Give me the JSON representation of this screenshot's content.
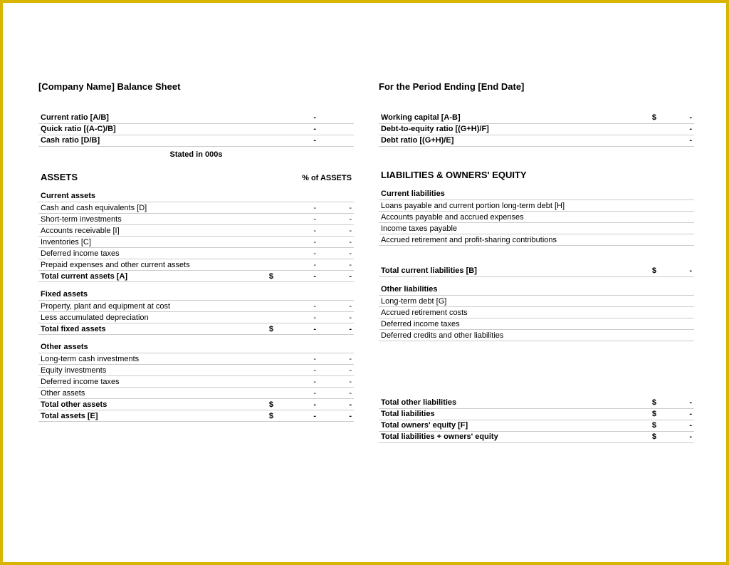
{
  "left": {
    "title": "[Company Name] Balance Sheet",
    "ratios": [
      {
        "label": "Current ratio  [A/B]",
        "value": "-"
      },
      {
        "label": "Quick ratio  [(A-C)/B]",
        "value": "-"
      },
      {
        "label": "Cash ratio  [D/B]",
        "value": "-"
      }
    ],
    "stated": "Stated in 000s",
    "section": "ASSETS",
    "pct_label": "% of ASSETS",
    "current_assets_head": "Current assets",
    "current_assets": [
      {
        "label": "Cash and cash equivalents  [D]",
        "v1": "-",
        "v2": "-"
      },
      {
        "label": "Short-term investments",
        "v1": "-",
        "v2": "-"
      },
      {
        "label": "Accounts receivable  [I]",
        "v1": "-",
        "v2": "-"
      },
      {
        "label": "Inventories  [C]",
        "v1": "-",
        "v2": "-"
      },
      {
        "label": "Deferred income taxes",
        "v1": "-",
        "v2": "-"
      },
      {
        "label": "Prepaid expenses and other current assets",
        "v1": "-",
        "v2": "-"
      }
    ],
    "total_current_assets": {
      "label": "Total current assets  [A]",
      "cur": "$",
      "v1": "-",
      "v2": "-"
    },
    "fixed_assets_head": "Fixed assets",
    "fixed_assets": [
      {
        "label": "Property, plant and equipment at cost",
        "v1": "-",
        "v2": "-"
      },
      {
        "label": "Less accumulated depreciation",
        "v1": "-",
        "v2": "-"
      }
    ],
    "total_fixed_assets": {
      "label": "Total fixed assets",
      "cur": "$",
      "v1": "-",
      "v2": "-"
    },
    "other_assets_head": "Other assets",
    "other_assets": [
      {
        "label": "Long-term cash investments",
        "v1": "-",
        "v2": "-"
      },
      {
        "label": "Equity investments",
        "v1": "-",
        "v2": "-"
      },
      {
        "label": "Deferred income taxes",
        "v1": "-",
        "v2": "-"
      },
      {
        "label": "Other assets",
        "v1": "-",
        "v2": "-"
      }
    ],
    "total_other_assets": {
      "label": "Total other assets",
      "cur": "$",
      "v1": "-",
      "v2": "-"
    },
    "total_assets": {
      "label": "Total assets  [E]",
      "cur": "$",
      "v1": "-",
      "v2": "-"
    }
  },
  "right": {
    "title": "For the Period Ending [End Date]",
    "ratios": [
      {
        "label": "Working capital  [A-B]",
        "cur": "$",
        "value": "-"
      },
      {
        "label": "Debt-to-equity ratio  [(G+H)/F]",
        "cur": "",
        "value": "-"
      },
      {
        "label": "Debt ratio  [(G+H)/E]",
        "cur": "",
        "value": "-"
      }
    ],
    "section": "LIABILITIES & OWNERS' EQUITY",
    "current_liab_head": "Current liabilities",
    "current_liab": [
      {
        "label": "Loans payable and current portion long-term debt  [H]"
      },
      {
        "label": "Accounts payable and accrued expenses"
      },
      {
        "label": "Income taxes payable"
      },
      {
        "label": "Accrued retirement and profit-sharing contributions"
      }
    ],
    "total_current_liab": {
      "label": "Total current liabilities  [B]",
      "cur": "$",
      "v1": "-"
    },
    "other_liab_head": "Other liabilities",
    "other_liab": [
      {
        "label": "Long-term debt  [G]"
      },
      {
        "label": "Accrued retirement costs"
      },
      {
        "label": "Deferred income taxes"
      },
      {
        "label": "Deferred credits and other liabilities"
      }
    ],
    "totals": [
      {
        "label": "Total other liabilities",
        "cur": "$",
        "v1": "-"
      },
      {
        "label": "Total liabilities",
        "cur": "$",
        "v1": "-"
      },
      {
        "label": "Total owners' equity  [F]",
        "cur": "$",
        "v1": "-"
      },
      {
        "label": "Total liabilities + owners' equity",
        "cur": "$",
        "v1": "-"
      }
    ]
  }
}
